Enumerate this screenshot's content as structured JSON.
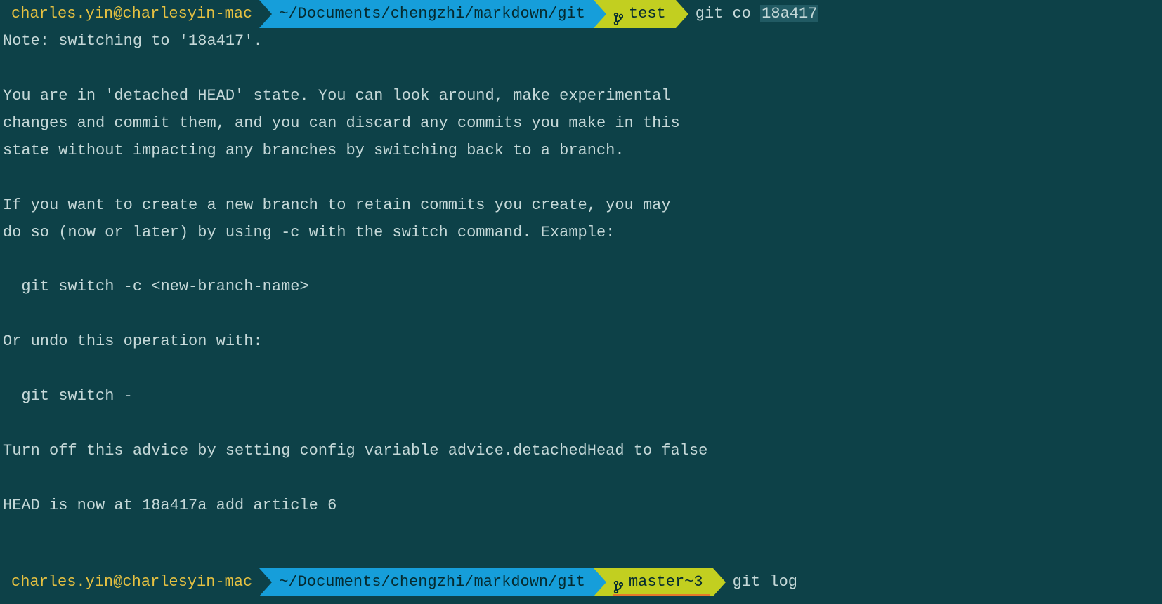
{
  "prompt1": {
    "user": "charles.yin@charlesyin-mac",
    "path": "~/Documents/chengzhi/markdown/git",
    "branch": "test",
    "command_prefix": "git co ",
    "command_arg": "18a417"
  },
  "output_lines": [
    "Note: switching to '18a417'.",
    "",
    "You are in 'detached HEAD' state. You can look around, make experimental",
    "changes and commit them, and you can discard any commits you make in this",
    "state without impacting any branches by switching back to a branch.",
    "",
    "If you want to create a new branch to retain commits you create, you may",
    "do so (now or later) by using -c with the switch command. Example:",
    "",
    "  git switch -c <new-branch-name>",
    "",
    "Or undo this operation with:",
    "",
    "  git switch -",
    "",
    "Turn off this advice by setting config variable advice.detachedHead to false",
    "",
    "HEAD is now at 18a417a add article 6"
  ],
  "prompt2": {
    "user": "charles.yin@charlesyin-mac",
    "path": "~/Documents/chengzhi/markdown/git",
    "branch": "master~3",
    "command": "git log"
  }
}
